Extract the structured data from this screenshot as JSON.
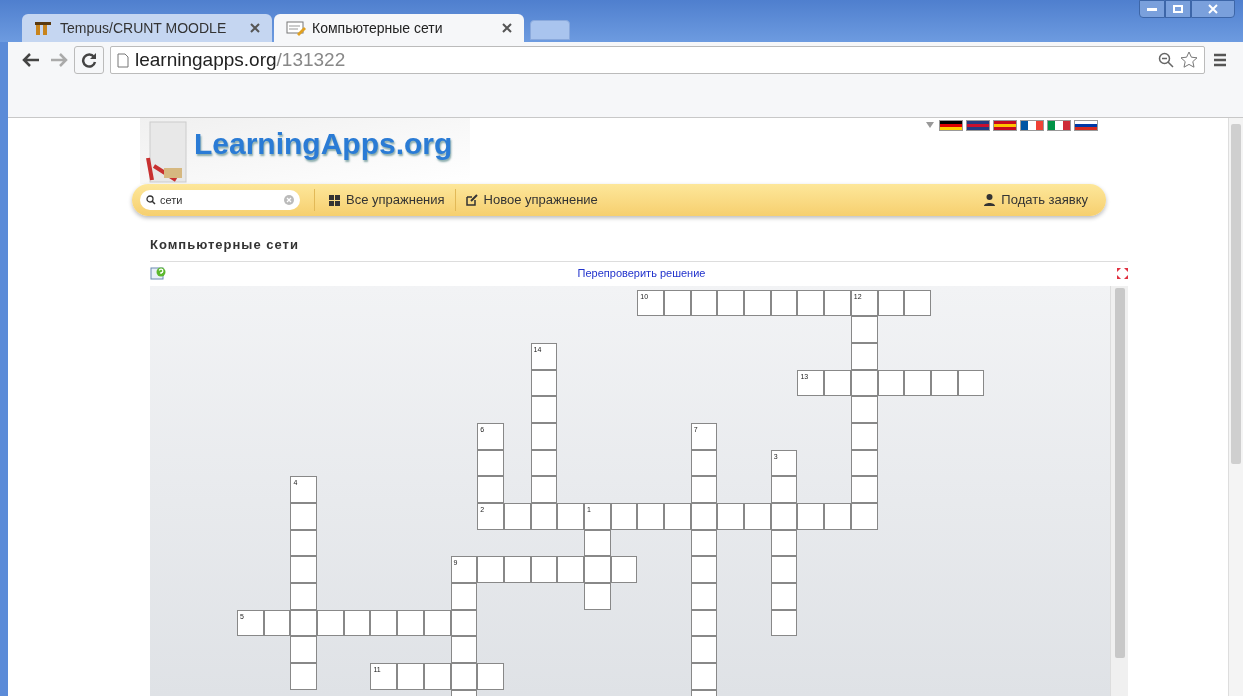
{
  "browser": {
    "tabs": [
      {
        "title": "Tempus/CRUNT MOODLE",
        "selected": false
      },
      {
        "title": "Компьютерные сети",
        "selected": true
      }
    ],
    "address": {
      "host": "learningapps.org",
      "path": "/131322"
    }
  },
  "site": {
    "logo": "LearningApps.org",
    "search": {
      "value": "сети"
    },
    "nav": [
      {
        "label": "Все упражнения",
        "kind": "grid"
      },
      {
        "label": "Новое упражнение",
        "kind": "edit"
      }
    ],
    "account": {
      "label": "Подать заявку"
    }
  },
  "exercise": {
    "title": "Компьютерные сети",
    "check_link": "Перепроверить решение",
    "crossword": {
      "rows": [
        [
          {
            "kind": "gap"
          },
          {
            "kind": "gap"
          },
          {
            "kind": "gap"
          },
          {
            "kind": "gap"
          },
          {
            "kind": "gap"
          },
          {
            "kind": "gap"
          },
          {
            "kind": "gap"
          },
          {
            "kind": "gap"
          },
          {
            "kind": "gap"
          },
          {
            "kind": "gap"
          },
          {
            "kind": "gap"
          },
          {
            "kind": "gap"
          },
          {
            "kind": "gap"
          },
          {
            "kind": "gap"
          },
          {
            "kind": "gap"
          },
          {
            "kind": "letter",
            "number": "10"
          },
          {
            "kind": "letter"
          },
          {
            "kind": "letter"
          },
          {
            "kind": "letter"
          },
          {
            "kind": "letter"
          },
          {
            "kind": "letter"
          },
          {
            "kind": "letter"
          },
          {
            "kind": "letter"
          },
          {
            "kind": "letter",
            "number": "12"
          },
          {
            "kind": "letter"
          },
          {
            "kind": "letter"
          }
        ],
        [
          {
            "kind": "gap"
          },
          {
            "kind": "gap"
          },
          {
            "kind": "gap"
          },
          {
            "kind": "gap"
          },
          {
            "kind": "gap"
          },
          {
            "kind": "gap"
          },
          {
            "kind": "gap"
          },
          {
            "kind": "gap"
          },
          {
            "kind": "gap"
          },
          {
            "kind": "gap"
          },
          {
            "kind": "gap"
          },
          {
            "kind": "gap"
          },
          {
            "kind": "gap"
          },
          {
            "kind": "gap"
          },
          {
            "kind": "gap"
          },
          {
            "kind": "gap"
          },
          {
            "kind": "gap"
          },
          {
            "kind": "gap"
          },
          {
            "kind": "gap"
          },
          {
            "kind": "gap"
          },
          {
            "kind": "gap"
          },
          {
            "kind": "gap"
          },
          {
            "kind": "gap"
          },
          {
            "kind": "letter"
          }
        ],
        [
          {
            "kind": "gap"
          },
          {
            "kind": "gap"
          },
          {
            "kind": "gap"
          },
          {
            "kind": "gap"
          },
          {
            "kind": "gap"
          },
          {
            "kind": "gap"
          },
          {
            "kind": "gap"
          },
          {
            "kind": "gap"
          },
          {
            "kind": "gap"
          },
          {
            "kind": "gap"
          },
          {
            "kind": "gap"
          },
          {
            "kind": "letter",
            "number": "14"
          },
          {
            "kind": "gap"
          },
          {
            "kind": "gap"
          },
          {
            "kind": "gap"
          },
          {
            "kind": "gap"
          },
          {
            "kind": "gap"
          },
          {
            "kind": "gap"
          },
          {
            "kind": "gap"
          },
          {
            "kind": "gap"
          },
          {
            "kind": "gap"
          },
          {
            "kind": "gap"
          },
          {
            "kind": "gap"
          },
          {
            "kind": "letter"
          }
        ],
        [
          {
            "kind": "gap"
          },
          {
            "kind": "gap"
          },
          {
            "kind": "gap"
          },
          {
            "kind": "gap"
          },
          {
            "kind": "gap"
          },
          {
            "kind": "gap"
          },
          {
            "kind": "gap"
          },
          {
            "kind": "gap"
          },
          {
            "kind": "gap"
          },
          {
            "kind": "gap"
          },
          {
            "kind": "gap"
          },
          {
            "kind": "letter"
          },
          {
            "kind": "gap"
          },
          {
            "kind": "gap"
          },
          {
            "kind": "gap"
          },
          {
            "kind": "gap"
          },
          {
            "kind": "gap"
          },
          {
            "kind": "gap"
          },
          {
            "kind": "gap"
          },
          {
            "kind": "gap"
          },
          {
            "kind": "gap"
          },
          {
            "kind": "letter",
            "number": "13"
          },
          {
            "kind": "letter"
          },
          {
            "kind": "letter"
          },
          {
            "kind": "letter"
          },
          {
            "kind": "letter"
          },
          {
            "kind": "letter"
          },
          {
            "kind": "letter"
          }
        ],
        [
          {
            "kind": "gap"
          },
          {
            "kind": "gap"
          },
          {
            "kind": "gap"
          },
          {
            "kind": "gap"
          },
          {
            "kind": "gap"
          },
          {
            "kind": "gap"
          },
          {
            "kind": "gap"
          },
          {
            "kind": "gap"
          },
          {
            "kind": "gap"
          },
          {
            "kind": "gap"
          },
          {
            "kind": "gap"
          },
          {
            "kind": "letter"
          },
          {
            "kind": "gap"
          },
          {
            "kind": "gap"
          },
          {
            "kind": "gap"
          },
          {
            "kind": "gap"
          },
          {
            "kind": "gap"
          },
          {
            "kind": "gap"
          },
          {
            "kind": "gap"
          },
          {
            "kind": "gap"
          },
          {
            "kind": "gap"
          },
          {
            "kind": "gap"
          },
          {
            "kind": "gap"
          },
          {
            "kind": "letter"
          }
        ],
        [
          {
            "kind": "gap"
          },
          {
            "kind": "gap"
          },
          {
            "kind": "gap"
          },
          {
            "kind": "gap"
          },
          {
            "kind": "gap"
          },
          {
            "kind": "gap"
          },
          {
            "kind": "gap"
          },
          {
            "kind": "gap"
          },
          {
            "kind": "gap"
          },
          {
            "kind": "letter",
            "number": "6"
          },
          {
            "kind": "gap"
          },
          {
            "kind": "letter"
          },
          {
            "kind": "gap"
          },
          {
            "kind": "gap"
          },
          {
            "kind": "gap"
          },
          {
            "kind": "gap"
          },
          {
            "kind": "gap"
          },
          {
            "kind": "letter",
            "number": "7"
          },
          {
            "kind": "gap"
          },
          {
            "kind": "gap"
          },
          {
            "kind": "gap"
          },
          {
            "kind": "gap"
          },
          {
            "kind": "gap"
          },
          {
            "kind": "letter"
          }
        ],
        [
          {
            "kind": "gap"
          },
          {
            "kind": "gap"
          },
          {
            "kind": "gap"
          },
          {
            "kind": "gap"
          },
          {
            "kind": "gap"
          },
          {
            "kind": "gap"
          },
          {
            "kind": "gap"
          },
          {
            "kind": "gap"
          },
          {
            "kind": "gap"
          },
          {
            "kind": "letter"
          },
          {
            "kind": "gap"
          },
          {
            "kind": "letter"
          },
          {
            "kind": "gap"
          },
          {
            "kind": "gap"
          },
          {
            "kind": "gap"
          },
          {
            "kind": "gap"
          },
          {
            "kind": "gap"
          },
          {
            "kind": "letter"
          },
          {
            "kind": "gap"
          },
          {
            "kind": "gap"
          },
          {
            "kind": "letter",
            "number": "3"
          },
          {
            "kind": "gap"
          },
          {
            "kind": "gap"
          },
          {
            "kind": "letter"
          }
        ],
        [
          {
            "kind": "gap"
          },
          {
            "kind": "gap"
          },
          {
            "kind": "letter",
            "number": "4"
          },
          {
            "kind": "gap"
          },
          {
            "kind": "gap"
          },
          {
            "kind": "gap"
          },
          {
            "kind": "gap"
          },
          {
            "kind": "gap"
          },
          {
            "kind": "gap"
          },
          {
            "kind": "letter"
          },
          {
            "kind": "gap"
          },
          {
            "kind": "letter"
          },
          {
            "kind": "gap"
          },
          {
            "kind": "gap"
          },
          {
            "kind": "gap"
          },
          {
            "kind": "gap"
          },
          {
            "kind": "gap"
          },
          {
            "kind": "letter"
          },
          {
            "kind": "gap"
          },
          {
            "kind": "gap"
          },
          {
            "kind": "letter"
          },
          {
            "kind": "gap"
          },
          {
            "kind": "gap"
          },
          {
            "kind": "letter"
          }
        ],
        [
          {
            "kind": "gap"
          },
          {
            "kind": "gap"
          },
          {
            "kind": "letter"
          },
          {
            "kind": "gap"
          },
          {
            "kind": "gap"
          },
          {
            "kind": "gap"
          },
          {
            "kind": "gap"
          },
          {
            "kind": "gap"
          },
          {
            "kind": "gap"
          },
          {
            "kind": "letter",
            "number": "2"
          },
          {
            "kind": "letter"
          },
          {
            "kind": "letter"
          },
          {
            "kind": "letter"
          },
          {
            "kind": "letter",
            "number": "1"
          },
          {
            "kind": "letter"
          },
          {
            "kind": "letter"
          },
          {
            "kind": "letter"
          },
          {
            "kind": "letter"
          },
          {
            "kind": "letter"
          },
          {
            "kind": "letter"
          },
          {
            "kind": "letter"
          },
          {
            "kind": "letter"
          },
          {
            "kind": "letter"
          },
          {
            "kind": "letter"
          }
        ],
        [
          {
            "kind": "gap"
          },
          {
            "kind": "gap"
          },
          {
            "kind": "letter"
          },
          {
            "kind": "gap"
          },
          {
            "kind": "gap"
          },
          {
            "kind": "gap"
          },
          {
            "kind": "gap"
          },
          {
            "kind": "gap"
          },
          {
            "kind": "gap"
          },
          {
            "kind": "gap"
          },
          {
            "kind": "gap"
          },
          {
            "kind": "gap"
          },
          {
            "kind": "gap"
          },
          {
            "kind": "letter"
          },
          {
            "kind": "gap"
          },
          {
            "kind": "gap"
          },
          {
            "kind": "gap"
          },
          {
            "kind": "letter"
          },
          {
            "kind": "gap"
          },
          {
            "kind": "gap"
          },
          {
            "kind": "letter"
          }
        ],
        [
          {
            "kind": "gap"
          },
          {
            "kind": "gap"
          },
          {
            "kind": "letter"
          },
          {
            "kind": "gap"
          },
          {
            "kind": "gap"
          },
          {
            "kind": "gap"
          },
          {
            "kind": "gap"
          },
          {
            "kind": "gap"
          },
          {
            "kind": "letter",
            "number": "9"
          },
          {
            "kind": "letter"
          },
          {
            "kind": "letter"
          },
          {
            "kind": "letter"
          },
          {
            "kind": "letter"
          },
          {
            "kind": "letter"
          },
          {
            "kind": "letter"
          },
          {
            "kind": "gap"
          },
          {
            "kind": "gap"
          },
          {
            "kind": "letter"
          },
          {
            "kind": "gap"
          },
          {
            "kind": "gap"
          },
          {
            "kind": "letter"
          }
        ],
        [
          {
            "kind": "gap"
          },
          {
            "kind": "gap"
          },
          {
            "kind": "letter"
          },
          {
            "kind": "gap"
          },
          {
            "kind": "gap"
          },
          {
            "kind": "gap"
          },
          {
            "kind": "gap"
          },
          {
            "kind": "gap"
          },
          {
            "kind": "letter"
          },
          {
            "kind": "gap"
          },
          {
            "kind": "gap"
          },
          {
            "kind": "gap"
          },
          {
            "kind": "gap"
          },
          {
            "kind": "letter"
          },
          {
            "kind": "gap"
          },
          {
            "kind": "gap"
          },
          {
            "kind": "gap"
          },
          {
            "kind": "letter"
          },
          {
            "kind": "gap"
          },
          {
            "kind": "gap"
          },
          {
            "kind": "letter"
          }
        ],
        [
          {
            "kind": "letter",
            "number": "5"
          },
          {
            "kind": "letter"
          },
          {
            "kind": "letter"
          },
          {
            "kind": "letter"
          },
          {
            "kind": "letter"
          },
          {
            "kind": "letter"
          },
          {
            "kind": "letter"
          },
          {
            "kind": "letter"
          },
          {
            "kind": "letter"
          },
          {
            "kind": "gap"
          },
          {
            "kind": "gap"
          },
          {
            "kind": "gap"
          },
          {
            "kind": "gap"
          },
          {
            "kind": "gap"
          },
          {
            "kind": "gap"
          },
          {
            "kind": "gap"
          },
          {
            "kind": "gap"
          },
          {
            "kind": "letter"
          },
          {
            "kind": "gap"
          },
          {
            "kind": "gap"
          },
          {
            "kind": "letter"
          }
        ],
        [
          {
            "kind": "gap"
          },
          {
            "kind": "gap"
          },
          {
            "kind": "letter"
          },
          {
            "kind": "gap"
          },
          {
            "kind": "gap"
          },
          {
            "kind": "gap"
          },
          {
            "kind": "gap"
          },
          {
            "kind": "gap"
          },
          {
            "kind": "letter"
          },
          {
            "kind": "gap"
          },
          {
            "kind": "gap"
          },
          {
            "kind": "gap"
          },
          {
            "kind": "gap"
          },
          {
            "kind": "gap"
          },
          {
            "kind": "gap"
          },
          {
            "kind": "gap"
          },
          {
            "kind": "gap"
          },
          {
            "kind": "letter"
          }
        ],
        [
          {
            "kind": "gap"
          },
          {
            "kind": "gap"
          },
          {
            "kind": "letter"
          },
          {
            "kind": "gap"
          },
          {
            "kind": "gap"
          },
          {
            "kind": "letter",
            "number": "11"
          },
          {
            "kind": "letter"
          },
          {
            "kind": "letter"
          },
          {
            "kind": "letter"
          },
          {
            "kind": "letter"
          },
          {
            "kind": "gap"
          },
          {
            "kind": "gap"
          },
          {
            "kind": "gap"
          },
          {
            "kind": "gap"
          },
          {
            "kind": "gap"
          },
          {
            "kind": "gap"
          },
          {
            "kind": "gap"
          },
          {
            "kind": "letter"
          }
        ],
        [
          {
            "kind": "gap"
          },
          {
            "kind": "gap"
          },
          {
            "kind": "gap"
          },
          {
            "kind": "gap"
          },
          {
            "kind": "gap"
          },
          {
            "kind": "gap"
          },
          {
            "kind": "gap"
          },
          {
            "kind": "gap"
          },
          {
            "kind": "letter"
          },
          {
            "kind": "gap"
          },
          {
            "kind": "gap"
          },
          {
            "kind": "gap"
          },
          {
            "kind": "gap"
          },
          {
            "kind": "gap"
          },
          {
            "kind": "gap"
          },
          {
            "kind": "gap"
          },
          {
            "kind": "gap"
          },
          {
            "kind": "letter"
          }
        ]
      ]
    }
  }
}
